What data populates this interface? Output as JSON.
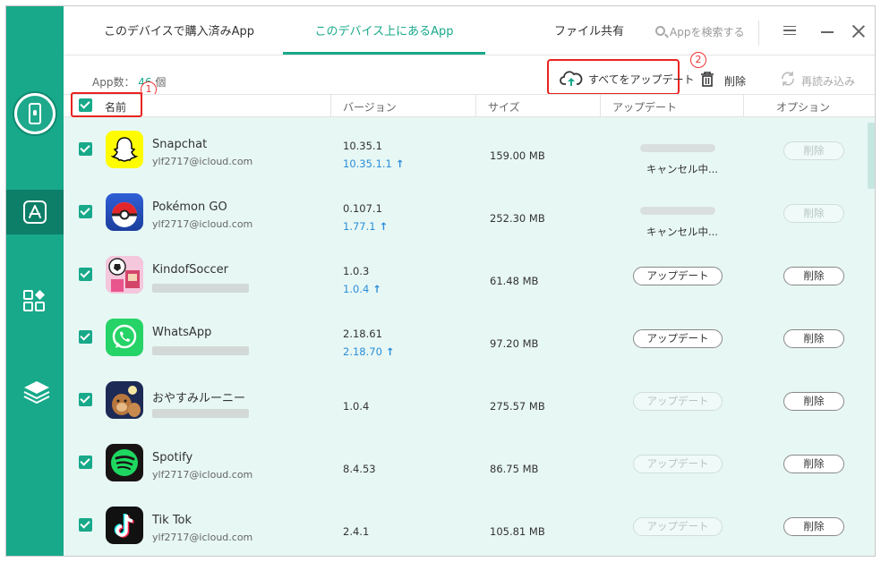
{
  "tabs": [
    {
      "label": "このデバイスで購入済みApp",
      "active": false
    },
    {
      "label": "このデバイス上にあるApp",
      "active": true
    },
    {
      "label": "ファイル共有",
      "active": false
    }
  ],
  "search": {
    "placeholder": "Appを検索する"
  },
  "toolbar": {
    "count_label": "App数：",
    "count": "46",
    "count_unit": "個",
    "update_all": "すべてをアップデート",
    "delete": "削除",
    "reload": "再読み込み"
  },
  "badges": {
    "one": "1",
    "two": "2"
  },
  "columns": {
    "name": "名前",
    "version": "バージョン",
    "size": "サイズ",
    "update": "アップデート",
    "option": "オプション"
  },
  "apps": [
    {
      "name": "Snapchat",
      "account": "ylf2717@icloud.com",
      "version": "10.35.1",
      "new_version": "10.35.1.1",
      "size": "159.00 MB",
      "update_status": "cancelling",
      "cancel_label": "キャンセル中...",
      "delete_label": "削除",
      "delete_enabled": false
    },
    {
      "name": "Pokémon GO",
      "account": "ylf2717@icloud.com",
      "version": "0.107.1",
      "new_version": "1.77.1",
      "size": "252.30 MB",
      "update_status": "cancelling",
      "cancel_label": "キャンセル中...",
      "delete_label": "削除",
      "delete_enabled": false
    },
    {
      "name": "KindofSoccer",
      "account": "",
      "version": "1.0.3",
      "new_version": "1.0.4",
      "size": "61.48 MB",
      "update_status": "available",
      "update_label": "アップデート",
      "delete_label": "削除",
      "delete_enabled": true
    },
    {
      "name": "WhatsApp",
      "account": "",
      "version": "2.18.61",
      "new_version": "2.18.70",
      "size": "97.20 MB",
      "update_status": "available",
      "update_label": "アップデート",
      "delete_label": "削除",
      "delete_enabled": true
    },
    {
      "name": "おやすみルーニー",
      "account": "",
      "version": "1.0.4",
      "new_version": "",
      "size": "275.57 MB",
      "update_status": "disabled",
      "update_label": "アップデート",
      "delete_label": "削除",
      "delete_enabled": true
    },
    {
      "name": "Spotify",
      "account": "ylf2717@icloud.com",
      "version": "8.4.53",
      "new_version": "",
      "size": "86.75 MB",
      "update_status": "disabled",
      "update_label": "アップデート",
      "delete_label": "削除",
      "delete_enabled": true
    },
    {
      "name": "Tik Tok",
      "account": "ylf2717@icloud.com",
      "version": "2.4.1",
      "new_version": "",
      "size": "105.81 MB",
      "update_status": "disabled",
      "update_label": "アップデート",
      "delete_label": "削除",
      "delete_enabled": true
    }
  ],
  "colors": {
    "accent": "#17a98a",
    "sidebar_active": "#0d7e67",
    "list_bg": "#e7f7f4",
    "highlight": "#e8231f",
    "link_blue": "#2b8fd9"
  }
}
